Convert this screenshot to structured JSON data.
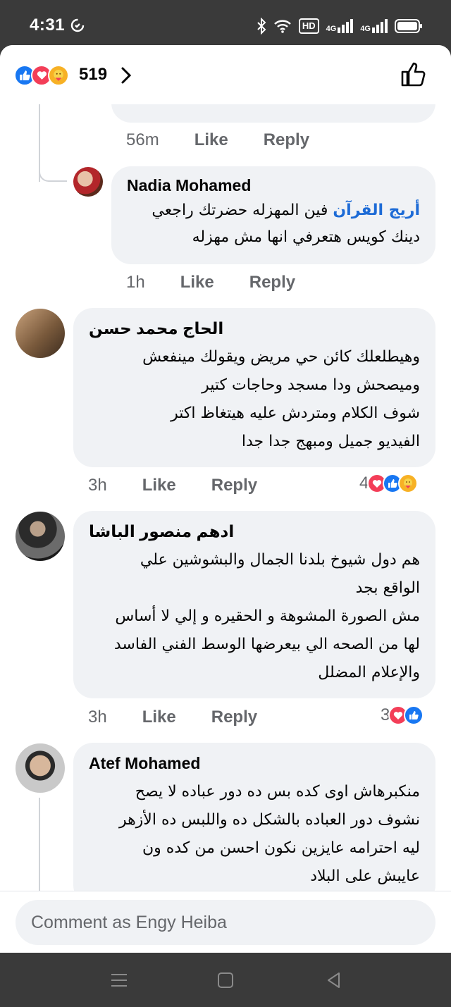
{
  "status": {
    "time": "4:31",
    "sync_icon": "sync-icon",
    "hd_label": "HD",
    "net1": "4G",
    "net2": "4G"
  },
  "header": {
    "reaction_count": "519"
  },
  "comments": [
    {
      "time": "56m",
      "like": "Like",
      "reply": "Reply"
    },
    {
      "author": "Nadia Mohamed",
      "tag": "أريج القرآن",
      "line1": " فين المهزله حضرتك راجعي",
      "line2": "دينك كويس هتعرفي انها مش مهزله",
      "time": "1h",
      "like": "Like",
      "reply": "Reply"
    },
    {
      "author": "الحاج محمد حسن",
      "lines": [
        "وهيطلعلك كائن حي مريض ويقولك مينفعش",
        "وميصحش ودا مسجد وحاجات كتير",
        "شوف الكلام ومتردش عليه هيتغاظ اكتر",
        "الفيديو جميل ومبهج جدا جدا"
      ],
      "time": "3h",
      "like": "Like",
      "reply": "Reply",
      "reaction_count": "4"
    },
    {
      "author": "ادهم منصور الباشا",
      "lines": [
        "هم دول شيوخ بلدنا الجمال والبشوشين علي",
        "الواقع بجد",
        "مش الصورة المشوهة و الحقيره و إلي لا أساس",
        "لها من الصحه الي بيعرضها الوسط الفني الفاسد",
        "والإعلام المضلل"
      ],
      "time": "3h",
      "like": "Like",
      "reply": "Reply",
      "reaction_count": "3"
    },
    {
      "author": "Atef Mohamed",
      "lines": [
        "منكبرهاش اوى كده بس ده دور عباده لا يصح",
        "نشوف دور العباده بالشكل ده واللبس ده الأزهر",
        "ليه احترامه عايزين نكون احسن من كده ون",
        "عايبش على البلاد"
      ]
    }
  ],
  "composer": {
    "placeholder": "Comment as Engy Heiba"
  },
  "colors": {
    "like": "#1877f2",
    "love": "#f33e58",
    "care": "#f7b125",
    "bubble": "#f0f2f5",
    "link": "#1d6bd6"
  }
}
